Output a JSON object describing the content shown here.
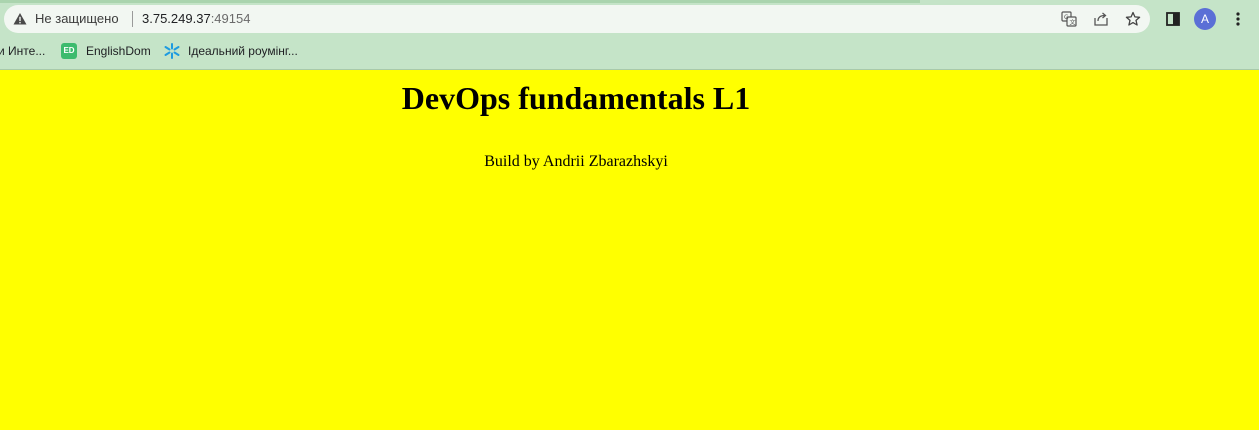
{
  "browser": {
    "security_label": "Не защищено",
    "url_host": "3.75.249.37",
    "url_port": ":49154",
    "profile_initial": "A",
    "icons": {
      "security": "warning-triangle-icon",
      "translate": "translate-icon",
      "share": "share-icon",
      "bookmark": "star-icon",
      "side_panel": "side-panel-icon",
      "menu": "kebab-menu-icon"
    }
  },
  "bookmarks": {
    "items": [
      {
        "label": "и Инте..."
      },
      {
        "badge": "ED",
        "label": "EnglishDom"
      },
      {
        "label": "Ідеальний роумінг..."
      }
    ]
  },
  "page": {
    "heading": "DevOps fundamentals L1",
    "byline": "Build by Andrii Zbarazhskyi",
    "background_color": "#ffff00"
  }
}
